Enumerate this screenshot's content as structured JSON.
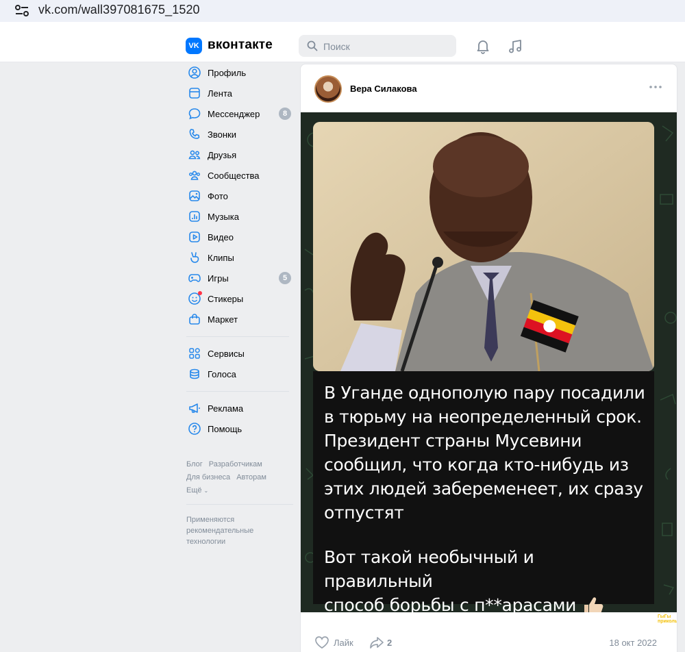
{
  "browser": {
    "url": "vk.com/wall397081675_1520"
  },
  "header": {
    "logo_text": "VK",
    "brand": "вконтакте",
    "search_placeholder": "Поиск"
  },
  "sidebar": {
    "items": [
      {
        "label": "Профиль",
        "icon": "user-circle-icon"
      },
      {
        "label": "Лента",
        "icon": "feed-icon"
      },
      {
        "label": "Мессенджер",
        "icon": "message-icon",
        "badge": "8"
      },
      {
        "label": "Звонки",
        "icon": "phone-icon"
      },
      {
        "label": "Друзья",
        "icon": "friends-icon"
      },
      {
        "label": "Сообщества",
        "icon": "communities-icon"
      },
      {
        "label": "Фото",
        "icon": "photo-icon"
      },
      {
        "label": "Музыка",
        "icon": "music-icon"
      },
      {
        "label": "Видео",
        "icon": "video-icon"
      },
      {
        "label": "Клипы",
        "icon": "clips-icon"
      },
      {
        "label": "Игры",
        "icon": "games-icon",
        "badge": "5"
      },
      {
        "label": "Стикеры",
        "icon": "sticker-icon"
      },
      {
        "label": "Маркет",
        "icon": "market-icon"
      }
    ],
    "items2": [
      {
        "label": "Сервисы",
        "icon": "services-icon"
      },
      {
        "label": "Голоса",
        "icon": "votes-icon"
      }
    ],
    "items3": [
      {
        "label": "Реклама",
        "icon": "ads-icon"
      },
      {
        "label": "Помощь",
        "icon": "help-icon"
      }
    ],
    "footer_links": [
      "Блог",
      "Разработчикам",
      "Для бизнеса",
      "Авторам",
      "Ещё"
    ],
    "recommend_text": "Применяются рекомендательные технологии"
  },
  "post": {
    "author": "Вера Силакова",
    "caption_lines": [
      "В Уганде однополую пару посадили",
      "в тюрьму на неопределенный срок.",
      "Президент страны Мусевини",
      "сообщил, что когда кто-нибудь из",
      "этих людей забеременеет, их сразу",
      "отпустят"
    ],
    "caption2_lines": [
      "Вот такой необычный и правильный",
      "способ борьбы с п**арасами"
    ],
    "watermark": "ГыГы приколы",
    "like_label": "Лайк",
    "share_count": "2",
    "date": "18 окт 2022"
  },
  "colors": {
    "accent": "#0077ff",
    "page_bg": "#edeef0",
    "muted": "#818c99"
  }
}
